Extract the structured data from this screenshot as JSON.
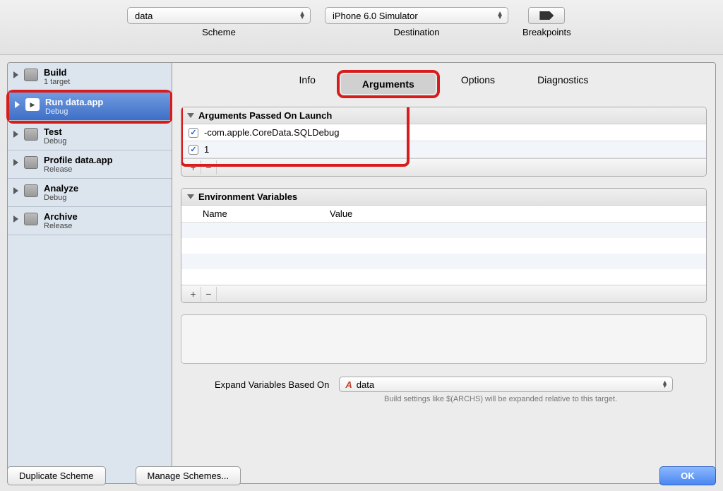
{
  "toolbar": {
    "scheme_value": "data",
    "scheme_label": "Scheme",
    "destination_value": "iPhone 6.0 Simulator",
    "destination_label": "Destination",
    "breakpoints_label": "Breakpoints"
  },
  "sidebar": {
    "items": [
      {
        "title": "Build",
        "sub": "1 target"
      },
      {
        "title": "Run data.app",
        "sub": "Debug"
      },
      {
        "title": "Test",
        "sub": "Debug"
      },
      {
        "title": "Profile data.app",
        "sub": "Release"
      },
      {
        "title": "Analyze",
        "sub": "Debug"
      },
      {
        "title": "Archive",
        "sub": "Release"
      }
    ]
  },
  "tabs": {
    "info": "Info",
    "arguments": "Arguments",
    "options": "Options",
    "diagnostics": "Diagnostics"
  },
  "args_section": {
    "heading": "Arguments Passed On Launch",
    "rows": [
      {
        "text": "-com.apple.CoreData.SQLDebug"
      },
      {
        "text": "1"
      }
    ]
  },
  "env_section": {
    "heading": "Environment Variables",
    "col_name": "Name",
    "col_value": "Value"
  },
  "expand": {
    "label": "Expand Variables Based On",
    "value": "data",
    "hint": "Build settings like $(ARCHS) will be expanded relative to this target."
  },
  "buttons": {
    "duplicate": "Duplicate Scheme",
    "manage": "Manage Schemes...",
    "ok": "OK",
    "plus": "+",
    "minus": "−"
  }
}
